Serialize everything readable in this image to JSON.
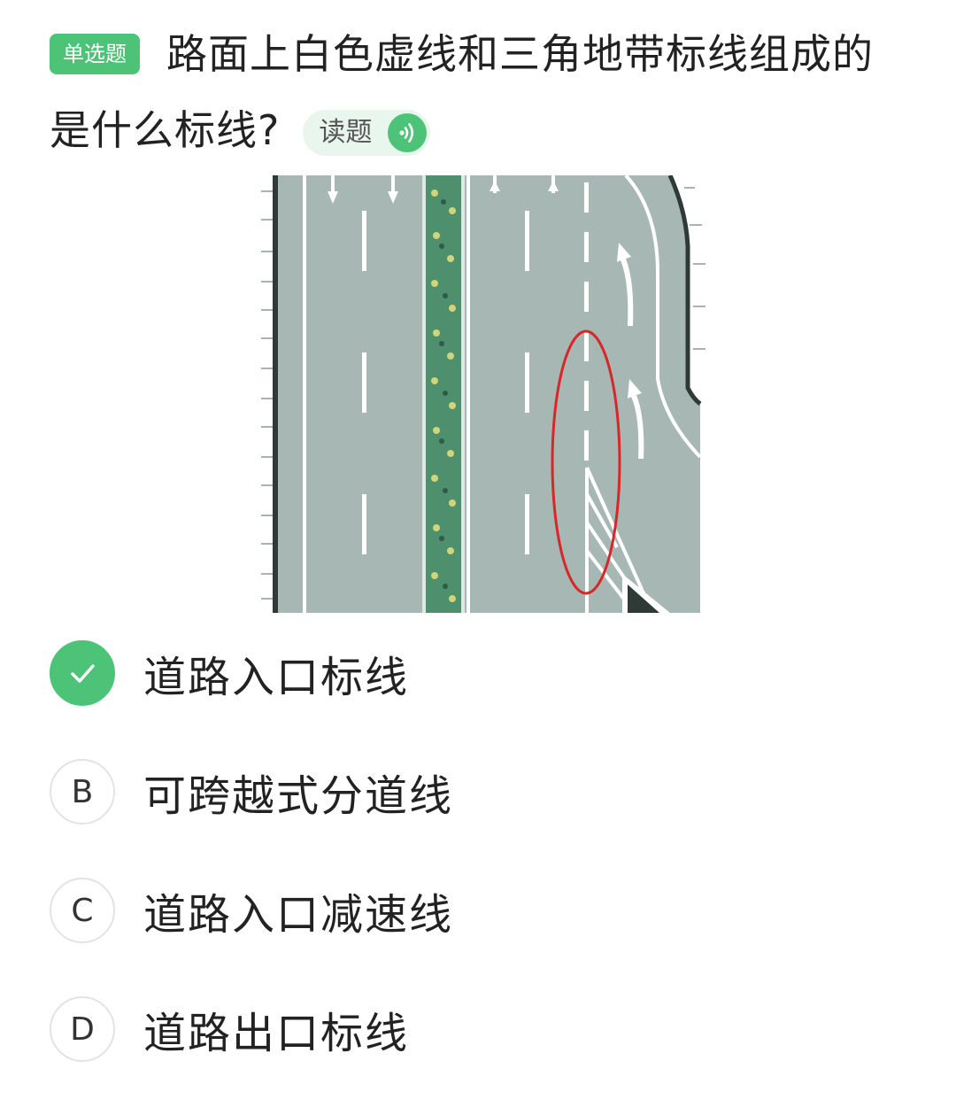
{
  "question": {
    "type_label": "单选题",
    "text": "路面上白色虚线和三角地带标线组成的是什么标线?",
    "read_button_label": "读题",
    "read_button_icon": "sound-wave-icon"
  },
  "colors": {
    "accent": "#4dc377",
    "road": "#a6b7b4",
    "highlight_ring": "#d62828"
  },
  "options": [
    {
      "key": "A",
      "text": "道路入口标线",
      "state": "correct",
      "icon": "checkmark-icon"
    },
    {
      "key": "B",
      "text": "可跨越式分道线",
      "state": "normal"
    },
    {
      "key": "C",
      "text": "道路入口减速线",
      "state": "normal"
    },
    {
      "key": "D",
      "text": "道路出口标线",
      "state": "normal"
    }
  ]
}
